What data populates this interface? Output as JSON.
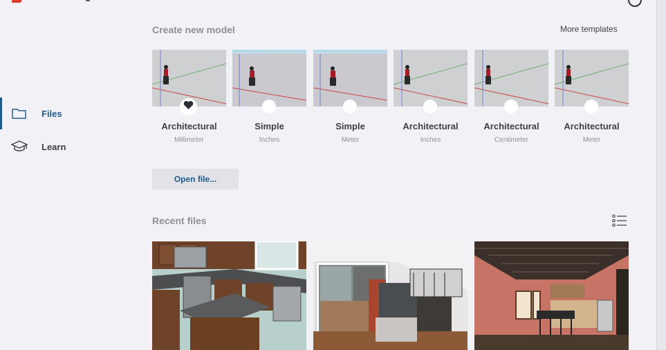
{
  "sidebar": {
    "items": [
      {
        "label": "Files",
        "icon": "folder-icon",
        "active": true
      },
      {
        "label": "Learn",
        "icon": "graduation-cap-icon",
        "active": false
      }
    ]
  },
  "create": {
    "title": "Create new model",
    "more_templates": "More templates",
    "templates": [
      {
        "name": "Architectural",
        "unit": "Millimeter",
        "favorite": true
      },
      {
        "name": "Simple",
        "unit": "Inches",
        "favorite": false
      },
      {
        "name": "Simple",
        "unit": "Meter",
        "favorite": false
      },
      {
        "name": "Architectural",
        "unit": "Inches",
        "favorite": false
      },
      {
        "name": "Architectural",
        "unit": "Centimeter",
        "favorite": false
      },
      {
        "name": "Architectural",
        "unit": "Meter",
        "favorite": false
      }
    ],
    "open_file": "Open file..."
  },
  "recent": {
    "title": "Recent files",
    "view_icon": "list-view-icon",
    "files": [
      {
        "thumbnail": "kitchen-model-thumbnail"
      },
      {
        "thumbnail": "loft-model-thumbnail"
      },
      {
        "thumbnail": "brick-interior-model-thumbnail"
      }
    ]
  },
  "colors": {
    "accent": "#1f5c8b",
    "background": "#f2f2f6",
    "muted_text": "#8d9097",
    "button_bg": "#e2e2e7"
  }
}
